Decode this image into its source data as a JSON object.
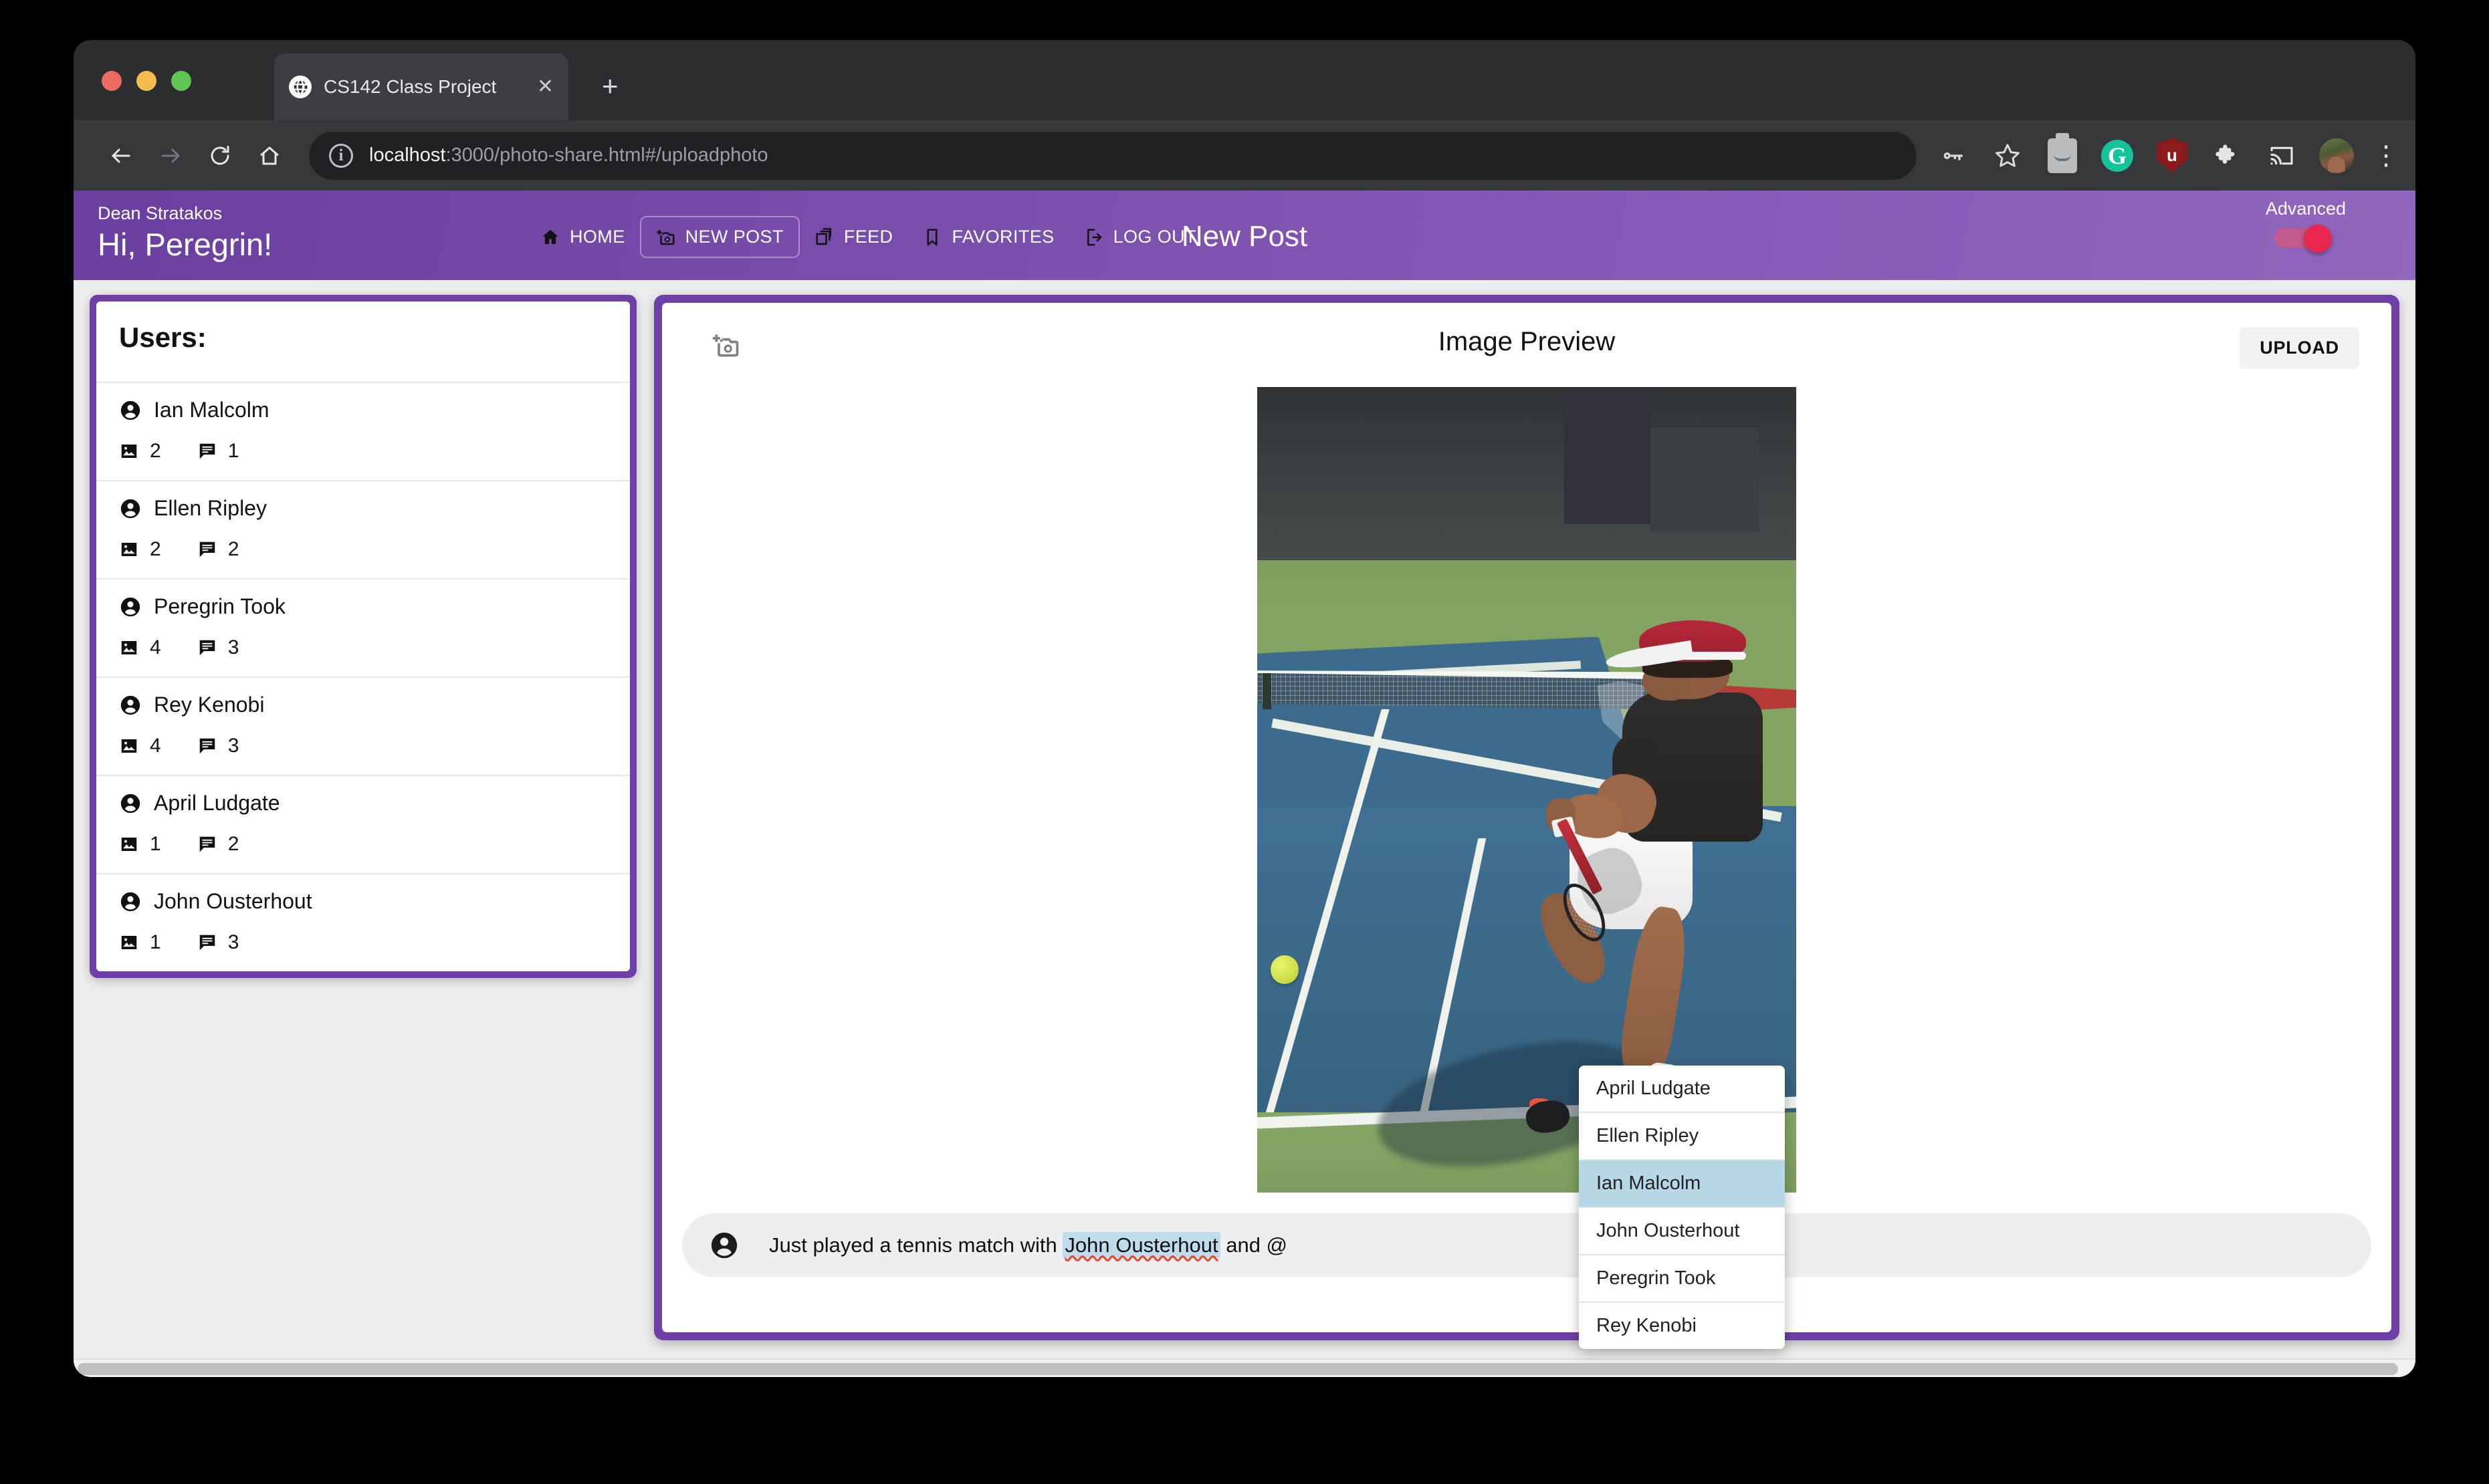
{
  "browser": {
    "tab": {
      "title": "CS142 Class Project",
      "favicon": "globe-icon",
      "close": "✕"
    },
    "new_tab": "+",
    "nav": {
      "back": "←",
      "forward": "→",
      "reload": "↻",
      "home": "⌂"
    },
    "omnibox": {
      "site_info": "i",
      "host": "localhost",
      "path": ":3000/photo-share.html#/uploadphoto"
    },
    "toolbar_icons": [
      "password-key-icon",
      "bookmark-star-icon",
      "extension-generic-icon",
      "grammarly-extension-icon",
      "ublock-extension-icon",
      "extensions-puzzle-icon",
      "cast-icon",
      "profile-avatar",
      "browser-menu-icon"
    ],
    "grammarly_letter": "G",
    "ublock_letter": "u",
    "menu_dots": "⋮"
  },
  "app_header": {
    "author": "Dean Stratakos",
    "greeting": "Hi, Peregrin!",
    "page_title": "New Post",
    "nav_items": [
      {
        "label": "HOME",
        "icon": "home-icon",
        "active": false
      },
      {
        "label": "NEW POST",
        "icon": "add-photo-icon",
        "active": true
      },
      {
        "label": "FEED",
        "icon": "feed-icon",
        "active": false
      },
      {
        "label": "FAVORITES",
        "icon": "bookmark-icon",
        "active": false
      },
      {
        "label": "LOG OUT",
        "icon": "logout-icon",
        "active": false
      }
    ],
    "advanced_label": "Advanced",
    "advanced_enabled": true,
    "colors": {
      "header_gradient_start": "#6b3fa0",
      "header_gradient_end": "#9166bd",
      "toggle_knob": "#e8274f",
      "toggle_track": "#c25a8e"
    }
  },
  "sidebar": {
    "title": "Users:",
    "users": [
      {
        "name": "Ian Malcolm",
        "photos": "2",
        "comments": "1"
      },
      {
        "name": "Ellen Ripley",
        "photos": "2",
        "comments": "2"
      },
      {
        "name": "Peregrin Took",
        "photos": "4",
        "comments": "3"
      },
      {
        "name": "Rey Kenobi",
        "photos": "4",
        "comments": "3"
      },
      {
        "name": "April Ludgate",
        "photos": "1",
        "comments": "2"
      },
      {
        "name": "John Ousterhout",
        "photos": "1",
        "comments": "3"
      }
    ]
  },
  "post": {
    "add_photo_icon": "add-photo-icon",
    "preview_title": "Image Preview",
    "upload_label": "UPLOAD",
    "photo_alt": "tennis-player-photo",
    "caption": {
      "avatar": "account-circle-icon",
      "prefix": "Just played a tennis match with ",
      "mention": "John Ousterhout",
      "suffix": " and @"
    },
    "mention_dropdown": {
      "items": [
        {
          "label": "April Ludgate",
          "selected": false
        },
        {
          "label": "Ellen Ripley",
          "selected": false
        },
        {
          "label": "Ian Malcolm",
          "selected": true
        },
        {
          "label": "John Ousterhout",
          "selected": false
        },
        {
          "label": "Peregrin Took",
          "selected": false
        },
        {
          "label": "Rey Kenobi",
          "selected": false
        }
      ],
      "highlight_color": "#b5d7e6"
    }
  },
  "colors": {
    "card_border_purple": "#6f3fa8",
    "page_background": "#ececec",
    "mention_chip": "#bfdced"
  }
}
